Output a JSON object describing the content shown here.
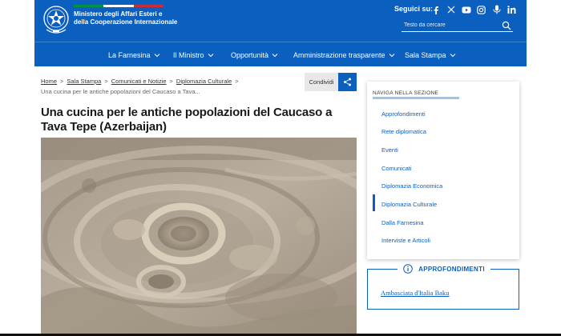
{
  "header": {
    "ministry_name": "Ministero degli Affari Esteri e della Cooperazione Internazionale",
    "social_label": "Seguici su:",
    "social_icons": [
      "facebook-icon",
      "x-icon",
      "youtube-icon",
      "instagram-icon",
      "podcast-icon",
      "linkedin-icon"
    ],
    "search_placeholder": "Testo da cercare",
    "brand_color": "#0b5fbf",
    "tricolor": [
      "#009246",
      "#ffffff",
      "#ce2b37"
    ]
  },
  "nav": {
    "items": [
      "La Farnesina",
      "Il Ministro",
      "Opportunità",
      "Amministrazione trasparente",
      "Sala Stampa"
    ]
  },
  "breadcrumb": {
    "items": [
      "Home",
      "Sala Stampa",
      "Comunicati e Notizie",
      "Diplomazia Culturale"
    ],
    "current": "Una cucina per le antiche popolazioni del Caucaso a Tava..."
  },
  "share": {
    "label": "Condividi"
  },
  "article": {
    "title": "Una cucina per le antiche popolazioni del Caucaso a Tava Tepe (Azerbaijan)"
  },
  "sidebar": {
    "header": "NAVIGA NELLA SEZIONE",
    "items": [
      "Approfondimenti",
      "Rete diplomatica",
      "Eventi",
      "Comunicati",
      "Diplomazia Economica",
      "Diplomazia Culturale",
      "Dalla Farnesina",
      "Interviste e Articoli"
    ],
    "active_item": "Diplomazia Culturale"
  },
  "approfondimenti": {
    "heading": "APPROFONDIMENTI",
    "link": "Ambasciata d'Italia Baku"
  }
}
